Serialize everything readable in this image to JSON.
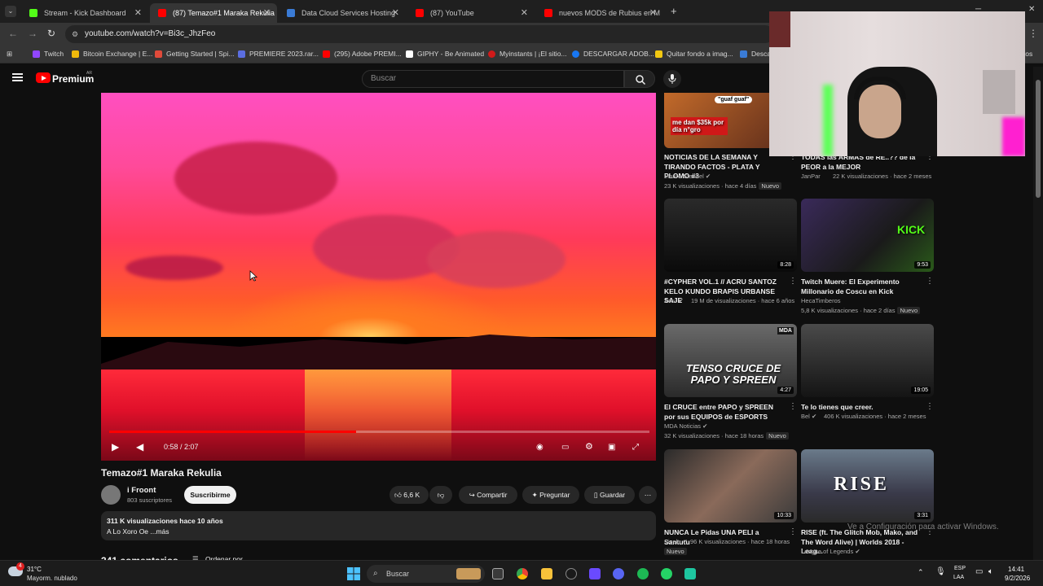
{
  "browser": {
    "tabs": [
      {
        "label": "Stream - Kick Dashboard",
        "favicon_color": "#53fc18"
      },
      {
        "label": "(87) Temazo#1 Maraka Rekulia",
        "favicon_color": "#ff0000"
      },
      {
        "label": "Data Cloud Services Hosting",
        "favicon_color": "#3a7bd5"
      },
      {
        "label": "(87) YouTube",
        "favicon_color": "#ff0000"
      },
      {
        "label": "nuevos MODS de Rubius en M",
        "favicon_color": "#ff0000"
      }
    ],
    "new_tab_symbol": "+",
    "url": "youtube.com/watch?v=Bi3c_JhzFeo",
    "bookmarks": [
      {
        "label": "Twitch",
        "color": "#9146ff"
      },
      {
        "label": "Bitcoin Exchange | E...",
        "color": "#f0b90b"
      },
      {
        "label": "Getting Started | Spi...",
        "color": "#e04a3a"
      },
      {
        "label": "PREMIERE 2023.rar...",
        "color": "#5b6ee1"
      },
      {
        "label": "(295) Adobe PREMI...",
        "color": "#ff0000"
      },
      {
        "label": "GIPHY - Be Animated",
        "color": "#ffffff"
      },
      {
        "label": "Myinstants | ¡El sitio...",
        "color": "#d11a1a"
      },
      {
        "label": "DESCARGAR ADOB...",
        "color": "#1877f2"
      },
      {
        "label": "Quitar fondo a imag...",
        "color": "#f2c811"
      },
      {
        "label": "Desca",
        "color": "#3a7bd5"
      }
    ],
    "bookmarks_overflow": "itos"
  },
  "youtube": {
    "brand": "Premium",
    "country": "AR",
    "search_placeholder": "Buscar",
    "accent": "#ff0000"
  },
  "player": {
    "time_current": "0:58",
    "time_total": "2:07",
    "time_display": "0:58 / 2:07",
    "progress_fraction": 0.457
  },
  "video": {
    "title": "Temazo#1 Maraka Rekulia",
    "channel": "i Froont",
    "subscribers": "803 suscriptores",
    "subscribe_label": "Suscribirme",
    "likes": "6,6 K",
    "share_label": "Compartir",
    "ask_label": "Preguntar",
    "save_label": "Guardar",
    "views_line": "311 K visualizaciones  hace 10 años",
    "description": "A Lo Xoro Oe ...más",
    "comments_count": "341 comentarios",
    "sort_label": "Ordenar por"
  },
  "sidebar": {
    "videos": [
      {
        "title": "NOTICIAS DE LA SEMANA Y TIRANDO FACTOS - PLATA Y PLOMO #3",
        "channel": "Mauro Stendel",
        "verified": true,
        "meta": "23 K visualizaciones · hace 4 días",
        "badge": "Nuevo",
        "duration": "",
        "thumb_text": "me dan $35k por día n°gro",
        "thumb_text2": "\"guaf guaf\""
      },
      {
        "title": "TODAS las ARMAS de RE..?? de la PEOR a la MEJOR",
        "channel": "JanPar",
        "verified": false,
        "meta": "22 K visualizaciones · hace 2 meses",
        "badge": "",
        "duration": "",
        "thumb_text": "",
        "thumb_text2": ""
      },
      {
        "title": "#CYPHER VOL.1 // ACRU SANTOZ KELO KUNDO BRAPIS URBANSE SAJE",
        "channel": "Acru",
        "verified": true,
        "meta": "19 M de visualizaciones · hace 6 años",
        "badge": "",
        "duration": "8:28",
        "thumb_text": "",
        "thumb_text2": ""
      },
      {
        "title": "Twitch Muere: El Experimento Millonario de Coscu en Kick",
        "channel": "HecaTimberos",
        "verified": false,
        "meta": "5,8 K visualizaciones · hace 2 días",
        "badge": "Nuevo",
        "duration": "9:53",
        "thumb_text": "KICK",
        "thumb_text2": ""
      },
      {
        "title": "El CRUCE entre PAPO y SPREEN por sus EQUIPOS de ESPORTS",
        "channel": "MDA Noticias",
        "verified": true,
        "meta": "32 K visualizaciones · hace 18 horas",
        "badge": "Nuevo",
        "duration": "4:27",
        "thumb_text": "TENSO CRUCE DE PAPO Y SPREEN",
        "thumb_text2": "MDA"
      },
      {
        "title": "Te lo tienes que creer.",
        "channel": "Bel",
        "verified": true,
        "meta": "406 K visualizaciones · hace 2 meses",
        "badge": "",
        "duration": "19:05",
        "thumb_text": "",
        "thumb_text2": ""
      },
      {
        "title": "NUNCA Le Pidas UNA PELI a Santutu",
        "channel": "Sizelu",
        "verified": true,
        "meta": "96 K visualizaciones · hace 18 horas",
        "badge": "Nuevo",
        "duration": "10:33",
        "thumb_text": "",
        "thumb_text2": ""
      },
      {
        "title": "RISE (ft. The Glitch Mob, Mako, and The Word Alive) | Worlds 2018 - Leag...",
        "channel": "League of Legends",
        "verified": true,
        "meta": "",
        "badge": "",
        "duration": "3:31",
        "thumb_text": "RISE",
        "thumb_text2": ""
      }
    ]
  },
  "overlay": {
    "activate_windows": "Ve a Configuración para activar Windows."
  },
  "taskbar": {
    "temperature": "31°C",
    "weather": "Mayorm. nublado",
    "weather_alert": "4",
    "search_label": "Buscar",
    "lang_1": "ESP",
    "lang_2": "LAA",
    "time": "14:41",
    "date": "9/2/2026"
  }
}
